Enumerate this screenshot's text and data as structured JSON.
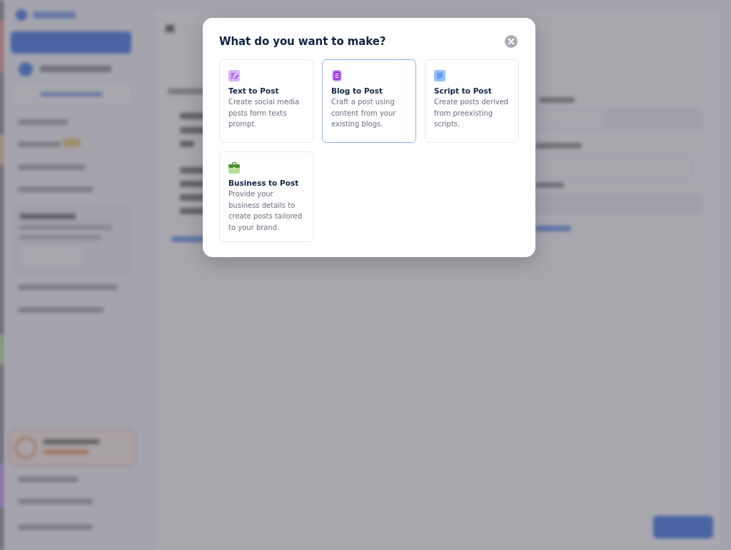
{
  "modal": {
    "title": "What do you want to make?",
    "options": [
      {
        "kind": "text",
        "title": "Text to Post",
        "description": "Create social media posts form texts prompt.",
        "selected": false
      },
      {
        "kind": "blog",
        "title": "Blog to Post",
        "description": "Craft a post using content from your existing blogs.",
        "selected": true
      },
      {
        "kind": "script",
        "title": "Script to Post",
        "description": "Create posts derived from preexisting scripts.",
        "selected": false
      },
      {
        "kind": "business",
        "title": "Business to Post",
        "description": "Provide your business details to create posts tailored to your brand.",
        "selected": false
      }
    ]
  }
}
